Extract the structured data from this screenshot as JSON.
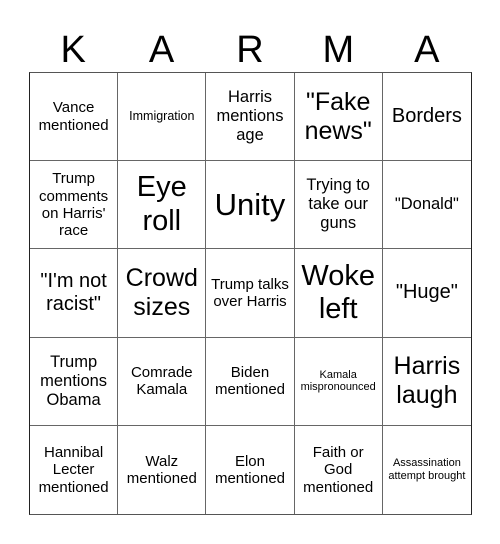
{
  "title_letters": [
    "K",
    "A",
    "R",
    "M",
    "A"
  ],
  "cells": [
    {
      "text": "Vance mentioned"
    },
    {
      "text": "Immigration"
    },
    {
      "text": "Harris mentions age"
    },
    {
      "text": "\"Fake news\""
    },
    {
      "text": "Borders"
    },
    {
      "text": "Trump comments on Harris' race"
    },
    {
      "text": "Eye roll"
    },
    {
      "text": "Unity"
    },
    {
      "text": "Trying to take our guns"
    },
    {
      "text": "\"Donald\""
    },
    {
      "text": "\"I'm not racist\""
    },
    {
      "text": "Crowd sizes"
    },
    {
      "text": "Trump talks over Harris"
    },
    {
      "text": "Woke left"
    },
    {
      "text": "\"Huge\""
    },
    {
      "text": "Trump mentions Obama"
    },
    {
      "text": "Comrade Kamala"
    },
    {
      "text": "Biden mentioned"
    },
    {
      "text": "Kamala mispronounced"
    },
    {
      "text": "Harris laugh"
    },
    {
      "text": "Hannibal Lecter mentioned"
    },
    {
      "text": "Walz mentioned"
    },
    {
      "text": "Elon mentioned"
    },
    {
      "text": "Faith or God mentioned"
    },
    {
      "text": "Assassination attempt brought"
    }
  ]
}
